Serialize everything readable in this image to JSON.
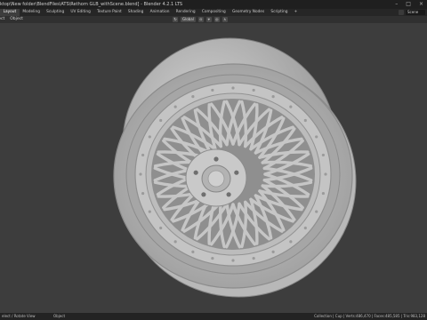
{
  "window": {
    "title": "ktop\\New folder\\BlendFiles\\ATS\\Rethorn GLB_withScene.blend] - Blender 4.2.1 LTS",
    "controls": [
      "–",
      "□",
      "×"
    ]
  },
  "workspace_tabs": [
    "Layout",
    "Modeling",
    "Sculpting",
    "UV Editing",
    "Texture Paint",
    "Shading",
    "Animation",
    "Rendering",
    "Compositing",
    "Geometry Nodes",
    "Scripting",
    "+"
  ],
  "scene_field": "Scene",
  "viewport_menu": [
    "ject",
    "Object"
  ],
  "toolbar": {
    "orientation": "Global"
  },
  "status": {
    "left": "elect / Rotate View",
    "mid": "Object",
    "right": "Collection | Cup | Verts:486,470 | Faces:485,585 | Tris:983,128"
  },
  "colors": {
    "background": "#3d3d3d",
    "wheel_base": "#bdbdbd"
  }
}
